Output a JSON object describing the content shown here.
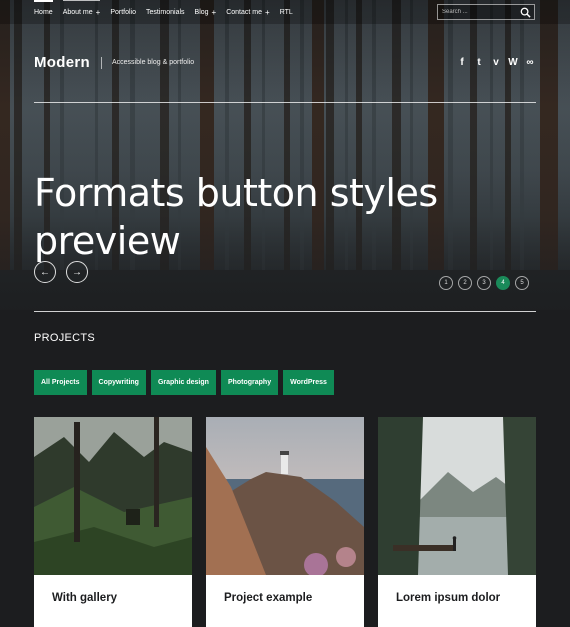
{
  "nav": {
    "items": [
      {
        "label": "Home",
        "plus": ""
      },
      {
        "label": "About me",
        "plus": "+"
      },
      {
        "label": "Portfolio",
        "plus": ""
      },
      {
        "label": "Testimonials",
        "plus": ""
      },
      {
        "label": "Blog",
        "plus": "+"
      },
      {
        "label": "Contact me",
        "plus": "+"
      },
      {
        "label": "RTL",
        "plus": ""
      }
    ],
    "search_placeholder": "Search ..."
  },
  "site": {
    "name": "Modern",
    "tagline": "Accessible blog & portfolio",
    "social": [
      "f",
      "t",
      "v",
      "W",
      "∞"
    ]
  },
  "hero": {
    "title": "Formats button styles preview",
    "prev_arrow": "←",
    "next_arrow": "→",
    "pages": [
      "1",
      "2",
      "3",
      "4",
      "5"
    ],
    "active_page": "4"
  },
  "projects": {
    "heading": "PROJECTS",
    "filters": [
      "All Projects",
      "Copywriting",
      "Graphic design",
      "Photography",
      "WordPress"
    ],
    "cards": [
      {
        "title": "With gallery"
      },
      {
        "title": "Project example"
      },
      {
        "title": "Lorem ipsum dolor"
      }
    ]
  },
  "colors": {
    "accent": "#0f8a55",
    "background": "#1c1d1f"
  }
}
